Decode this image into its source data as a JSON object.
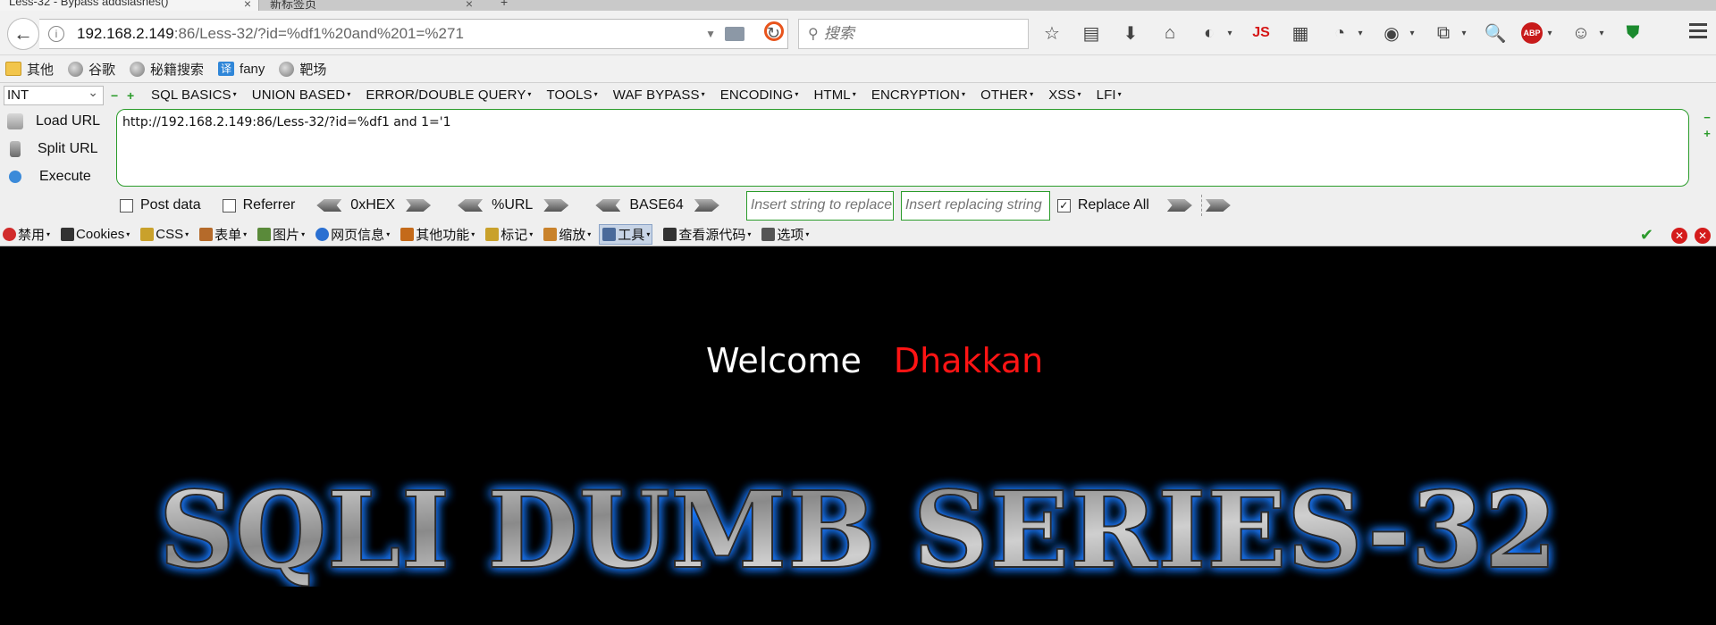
{
  "tabs": [
    {
      "label": "Less-32 - Bypass addslashes()",
      "close": "×"
    },
    {
      "label": "新标签页",
      "close": "×"
    }
  ],
  "new_tab": "+",
  "address": {
    "host": "192.168.2.149",
    "rest": ":86/Less-32/?id=%df1%20and%201=%271"
  },
  "search": {
    "placeholder": "搜索"
  },
  "toolbar_icons": [
    "bookmark-star",
    "reading-list",
    "download",
    "home",
    "sync",
    "js",
    "screenshot",
    "palette",
    "addon",
    "container",
    "zoom",
    "abp",
    "monkey",
    "shield"
  ],
  "toolbar_js_label": "JS",
  "toolbar_abp_label": "ABP",
  "bookmarks": [
    {
      "label": "其他",
      "icon": "folder"
    },
    {
      "label": "谷歌",
      "icon": "globe"
    },
    {
      "label": "秘籍搜索",
      "icon": "globe"
    },
    {
      "label": "fany",
      "icon": "translate",
      "glyph": "译"
    },
    {
      "label": "靶场",
      "icon": "globe"
    }
  ],
  "hackbar": {
    "select_value": "INT",
    "menus": [
      "SQL BASICS",
      "UNION BASED",
      "ERROR/DOUBLE QUERY",
      "TOOLS",
      "WAF BYPASS",
      "ENCODING",
      "HTML",
      "ENCRYPTION",
      "OTHER",
      "XSS",
      "LFI"
    ],
    "actions": [
      "Load URL",
      "Split URL",
      "Execute"
    ],
    "url_value": "http://192.168.2.149:86/Less-32/?id=%df1 and 1='1",
    "post_data_label": "Post data",
    "referrer_label": "Referrer",
    "encoders": [
      "0xHEX",
      "%URL",
      "BASE64"
    ],
    "replace_placeholder": "Insert string to replace",
    "replacing_placeholder": "Insert replacing string",
    "replace_all_label": "Replace All",
    "replace_all_checked": true
  },
  "webdev": [
    {
      "label": "禁用",
      "color": "#d12a2a"
    },
    {
      "label": "Cookies",
      "color": "#333333"
    },
    {
      "label": "CSS",
      "color": "#c9a12b"
    },
    {
      "label": "表单",
      "color": "#b56a2a"
    },
    {
      "label": "图片",
      "color": "#5a8a3a"
    },
    {
      "label": "网页信息",
      "color": "#2a6fd1"
    },
    {
      "label": "其他功能",
      "color": "#c46a1a"
    },
    {
      "label": "标记",
      "color": "#c9a12b"
    },
    {
      "label": "缩放",
      "color": "#c9822b"
    },
    {
      "label": "工具",
      "color": "#4a6a9a"
    },
    {
      "label": "查看源代码",
      "color": "#333333"
    },
    {
      "label": "选项",
      "color": "#555555"
    }
  ],
  "content": {
    "welcome": "Welcome",
    "name": "Dhakkan",
    "banner": "SQLI DUMB SERIES-32"
  }
}
